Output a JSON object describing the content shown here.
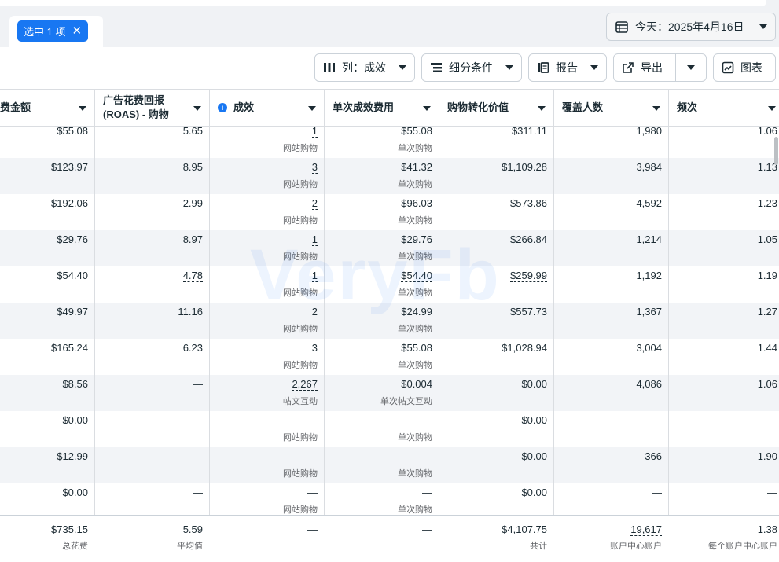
{
  "selection": {
    "label": "选中 1 项",
    "close": "✕"
  },
  "date": {
    "label": "今天：2025年4月16日"
  },
  "toolbar": {
    "columns": "列：成效",
    "breakdown": "细分条件",
    "reports": "报告",
    "export": "导出",
    "charts": "图表"
  },
  "headers": {
    "spend": "费金额",
    "roas_line1": "广告花费回报",
    "roas_line2": "(ROAS) - 购物",
    "results": "成效",
    "cpr": "单次成效费用",
    "conv_value": "购物转化价值",
    "reach": "覆盖人数",
    "frequency": "频次"
  },
  "rows": [
    {
      "spend": "$55.08",
      "roas": "5.65",
      "results": "1",
      "results_sub": "网站购物",
      "cpr": "$55.08",
      "cpr_sub": "单次购物",
      "value": "$311.11",
      "reach": "1,980",
      "freq": "1.06"
    },
    {
      "spend": "$123.97",
      "roas": "8.95",
      "results": "3",
      "results_sub": "网站购物",
      "cpr": "$41.32",
      "cpr_sub": "单次购物",
      "value": "$1,109.28",
      "reach": "3,984",
      "freq": "1.13"
    },
    {
      "spend": "$192.06",
      "roas": "2.99",
      "results": "2",
      "results_sub": "网站购物",
      "cpr": "$96.03",
      "cpr_sub": "单次购物",
      "value": "$573.86",
      "reach": "4,592",
      "freq": "1.23"
    },
    {
      "spend": "$29.76",
      "roas": "8.97",
      "results": "1",
      "results_sub": "网站购物",
      "cpr": "$29.76",
      "cpr_sub": "单次购物",
      "value": "$266.84",
      "reach": "1,214",
      "freq": "1.05"
    },
    {
      "spend": "$54.40",
      "roas": "4.78",
      "results": "1",
      "results_sub": "网站购物",
      "cpr": "$54.40",
      "cpr_sub": "单次购物",
      "value": "$259.99",
      "reach": "1,192",
      "freq": "1.19"
    },
    {
      "spend": "$49.97",
      "roas": "11.16",
      "results": "2",
      "results_sub": "网站购物",
      "cpr": "$24.99",
      "cpr_sub": "单次购物",
      "value": "$557.73",
      "reach": "1,367",
      "freq": "1.27"
    },
    {
      "spend": "$165.24",
      "roas": "6.23",
      "results": "3",
      "results_sub": "网站购物",
      "cpr": "$55.08",
      "cpr_sub": "单次购物",
      "value": "$1,028.94",
      "reach": "3,004",
      "freq": "1.44"
    },
    {
      "spend": "$8.56",
      "roas": "—",
      "results": "2,267",
      "results_sub": "帖文互动",
      "cpr": "$0.004",
      "cpr_sub": "单次帖文互动",
      "value": "$0.00",
      "reach": "4,086",
      "freq": "1.06"
    },
    {
      "spend": "$0.00",
      "roas": "—",
      "results": "—",
      "results_sub": "网站购物",
      "cpr": "—",
      "cpr_sub": "单次购物",
      "value": "$0.00",
      "reach": "—",
      "freq": "—"
    },
    {
      "spend": "$12.99",
      "roas": "—",
      "results": "—",
      "results_sub": "网站购物",
      "cpr": "—",
      "cpr_sub": "单次购物",
      "value": "$0.00",
      "reach": "366",
      "freq": "1.90"
    },
    {
      "spend": "$0.00",
      "roas": "—",
      "results": "—",
      "results_sub": "网站购物",
      "cpr": "—",
      "cpr_sub": "单次购物",
      "value": "$0.00",
      "reach": "—",
      "freq": "—"
    }
  ],
  "totals": {
    "spend": "$735.15",
    "spend_sub": "总花费",
    "roas": "5.59",
    "roas_sub": "平均值",
    "results": "—",
    "cpr": "—",
    "value": "$4,107.75",
    "value_sub": "共计",
    "reach": "19,617",
    "reach_sub": "账户中心账户",
    "freq": "1.38",
    "freq_sub": "每个账户中心账户"
  },
  "watermark": "VeryFb",
  "colors": {
    "accent": "#1877f2",
    "alt_row": "#f2f4f7",
    "border": "#dadde1"
  }
}
